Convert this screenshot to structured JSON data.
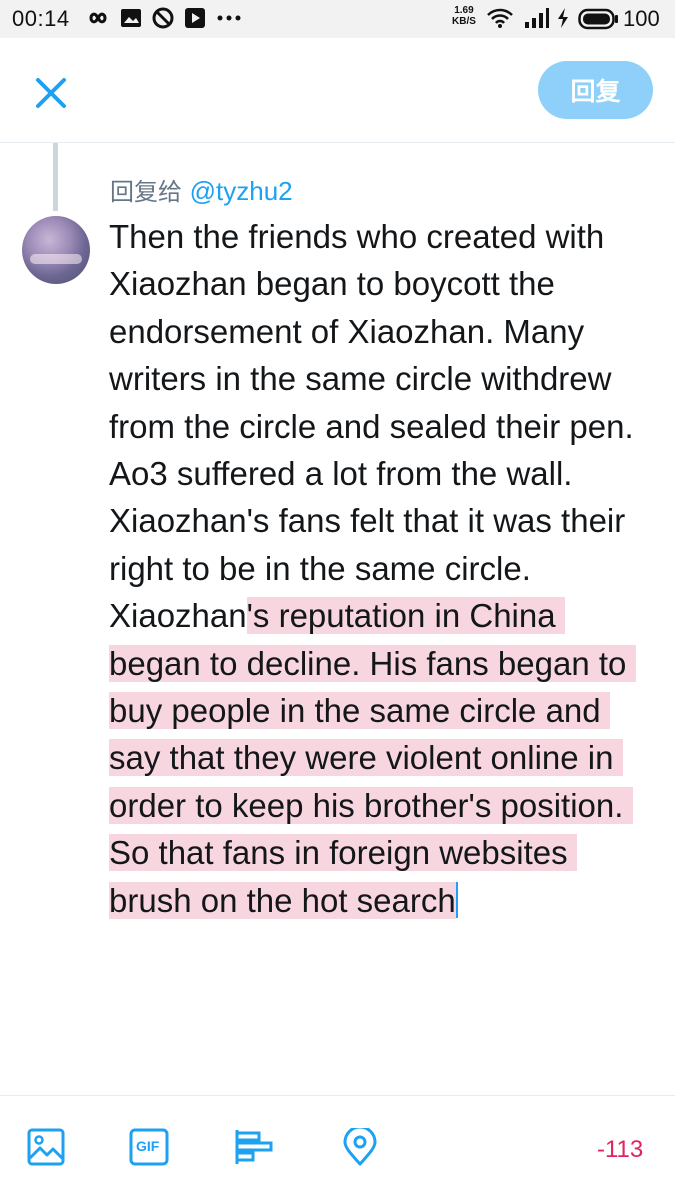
{
  "status_bar": {
    "time": "00:14",
    "net_speed_value": "1.69",
    "net_speed_unit": "KB/S",
    "battery": "100",
    "icons": [
      "infinity-icon",
      "image-notification-icon",
      "blocked-icon",
      "play-store-icon",
      "more-dots-icon",
      "wifi-icon",
      "signal-icon",
      "charging-icon",
      "battery-icon"
    ]
  },
  "header": {
    "reply_button_label": "回复"
  },
  "compose": {
    "reply_prefix": "回复给",
    "reply_handle": "@tyzhu2",
    "text_plain": "Then the friends who created with Xiaozhan began to boycott the endorsement of Xiaozhan. Many writers in the same circle withdrew from the circle and sealed their pen. Ao3 suffered a lot from the wall. Xiaozhan's fans felt that it was their right to be in the same circle. Xiaozhan",
    "text_selected": "'s reputation in China began to decline. His fans began to buy people in the same circle and say that they were violent online in order to keep his brother's position. So that fans in foreign websites brush on the hot search"
  },
  "toolbar": {
    "icons": [
      "image-icon",
      "gif-icon",
      "poll-icon",
      "location-icon"
    ],
    "gif_label": "GIF",
    "char_counter": "-113"
  },
  "colors": {
    "accent": "#1da1f2",
    "reply_button_bg": "#8ed0f9",
    "selection_highlight": "#f8d6e0",
    "counter_over_limit": "#e0245e"
  }
}
